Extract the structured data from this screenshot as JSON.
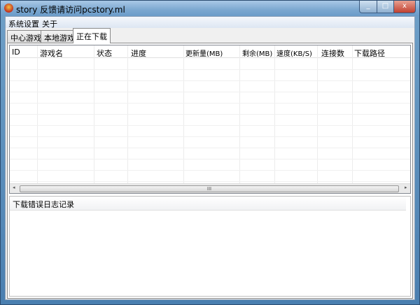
{
  "window": {
    "title": "story 反馈请访问pcstory.ml",
    "min": "_",
    "max": "□",
    "close": "x"
  },
  "menu": [
    "系统设置",
    "关于"
  ],
  "tabs": [
    "中心游戏",
    "本地游戏",
    "正在下载"
  ],
  "columns": [
    "ID",
    "游戏名",
    "状态",
    "进度",
    "更新量(MB)",
    "剩余(MB)",
    "速度(KB/S)",
    "连接数",
    "下载路径"
  ],
  "scroll": {
    "thumb": "III",
    "left": "◂",
    "right": "▸"
  },
  "log": {
    "header": "下载错误日志记录"
  }
}
